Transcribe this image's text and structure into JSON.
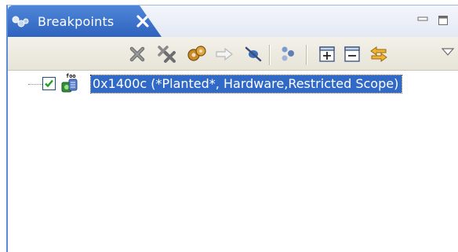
{
  "view": {
    "tab_title": "Breakpoints"
  },
  "toolbar": {
    "buttons": [
      {
        "name": "remove-breakpoint",
        "icon": "x-icon"
      },
      {
        "name": "remove-all-breakpoints",
        "icon": "double-x-icon"
      },
      {
        "name": "show-breakpoints-supported-by-target",
        "icon": "gears-icon"
      },
      {
        "name": "go-to-file",
        "icon": "arrow-right-icon"
      },
      {
        "name": "skip-all-breakpoints",
        "icon": "skip-breakpoint-icon"
      },
      {
        "name": "show-groups",
        "icon": "groups-icon"
      },
      {
        "name": "expand-all",
        "icon": "plus-box-icon"
      },
      {
        "name": "collapse-all",
        "icon": "minus-box-icon"
      },
      {
        "name": "link-with-debug-view",
        "icon": "link-arrows-icon"
      },
      {
        "name": "view-menu",
        "icon": "triangle-down-icon"
      }
    ]
  },
  "tree": {
    "items": [
      {
        "label": "0x1400c  (*Planted*, Hardware,Restricted Scope)",
        "checked": true,
        "icon": "hardware-breakpoint-icon",
        "icon_caption": "foo"
      }
    ]
  },
  "colors": {
    "tab_active": "#3a6fcb",
    "selection": "#3169c6",
    "toolbar_bg": "#ece9d8"
  }
}
